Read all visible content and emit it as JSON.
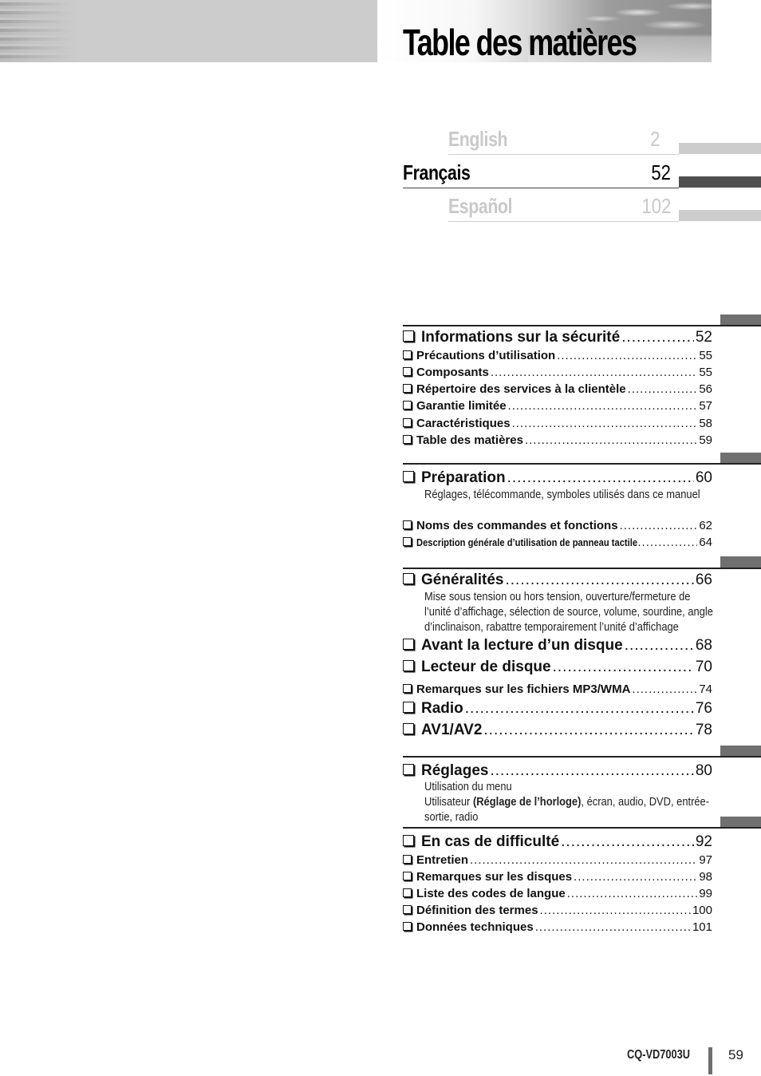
{
  "header": {
    "title": "Table des matières"
  },
  "languages": [
    {
      "name": "English",
      "page": "2",
      "active": false
    },
    {
      "name": "Français",
      "page": "52",
      "active": true
    },
    {
      "name": "Español",
      "page": "102",
      "active": false
    }
  ],
  "colors": {
    "active_lang_tab": "#505050",
    "inactive_lang_tab": "#cccccc",
    "inactive_text": "#c9c9c9",
    "section_tab": "#707070"
  },
  "sections": [
    {
      "main": {
        "label": "Informations sur la sécurité",
        "page": "52"
      },
      "items": [
        {
          "label": "Précautions d’utilisation",
          "page": "55"
        },
        {
          "label": "Composants",
          "page": "55"
        },
        {
          "label": "Répertoire des services à la clientèle",
          "page": "56"
        },
        {
          "label": "Garantie limitée",
          "page": "57"
        },
        {
          "label": "Caractéristiques",
          "page": "58"
        },
        {
          "label": "Table des matières",
          "page": "59"
        }
      ]
    },
    {
      "main": {
        "label": "Préparation",
        "page": "60",
        "description": "Réglages, télécommande, symboles utilisés dans ce manuel"
      },
      "items": [
        {
          "label": "Noms des commandes et fonctions",
          "page": "62"
        },
        {
          "label": "Description générale d’utilisation de panneau tactile",
          "page": "64"
        }
      ]
    },
    {
      "main": {
        "label": "Généralités",
        "page": "66",
        "description": "Mise sous tension ou hors tension, ouverture/fermeture de l’unité d’affichage, sélection de source, volume, sourdine, angle d’inclinaison, rabattre temporairement l’unité d’affichage"
      },
      "items": [
        {
          "label": "Avant la lecture d’un disque",
          "page": "68"
        },
        {
          "label": "Lecteur de disque",
          "page": "70"
        },
        {
          "label": "Remarques sur les fichiers MP3/WMA",
          "page": "74"
        },
        {
          "label": "Radio",
          "page": "76"
        },
        {
          "label": "AV1/AV2",
          "page": "78"
        }
      ]
    },
    {
      "main": {
        "label": "Réglages",
        "page": "80",
        "description_line1": "Utilisation du menu",
        "description_pre": "Utilisateur ",
        "description_bold": "(Réglage de l’horloge)",
        "description_post": ", écran, audio, DVD, entrée-sortie, radio"
      },
      "items": []
    },
    {
      "main": {
        "label": "En cas de difficulté",
        "page": "92"
      },
      "items": [
        {
          "label": "Entretien",
          "page": "97"
        },
        {
          "label": "Remarques sur les disques",
          "page": "98"
        },
        {
          "label": "Liste des codes de langue",
          "page": "99"
        },
        {
          "label": "Définition des termes",
          "page": "100"
        },
        {
          "label": "Données techniques",
          "page": "101"
        }
      ]
    }
  ],
  "footer": {
    "model": "CQ-VD7003U",
    "page_number": "59"
  }
}
